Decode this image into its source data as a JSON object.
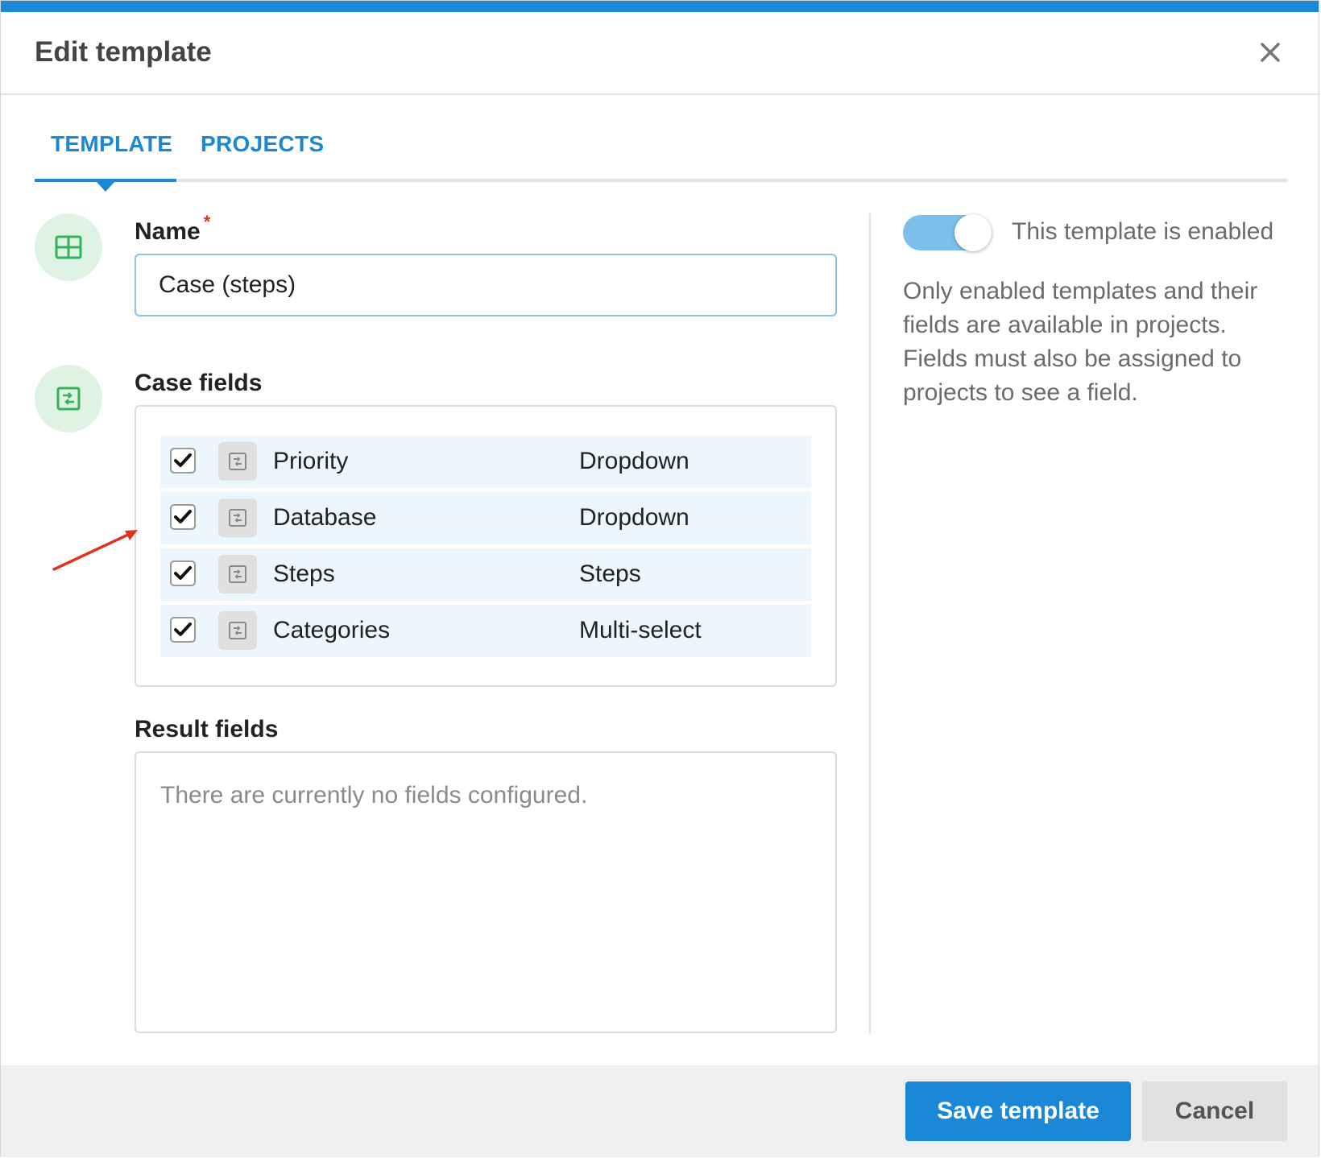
{
  "dialog": {
    "title": "Edit template",
    "accent_color": "#1a88d6"
  },
  "tabs": [
    {
      "label": "TEMPLATE",
      "active": true
    },
    {
      "label": "PROJECTS",
      "active": false
    }
  ],
  "name_field": {
    "label": "Name",
    "required_marker": "*",
    "value": "Case (steps)",
    "icon": "grid-icon"
  },
  "case_fields": {
    "label": "Case fields",
    "icon": "field-list-icon",
    "rows": [
      {
        "name": "Priority",
        "type": "Dropdown",
        "checked": true
      },
      {
        "name": "Database",
        "type": "Dropdown",
        "checked": true
      },
      {
        "name": "Steps",
        "type": "Steps",
        "checked": true
      },
      {
        "name": "Categories",
        "type": "Multi-select",
        "checked": true
      }
    ]
  },
  "result_fields": {
    "label": "Result fields",
    "empty_text": "There are currently no fields configured."
  },
  "status": {
    "toggle_label": "This template is enabled",
    "enabled": true,
    "help_text": "Only enabled templates and their fields are available in projects. Fields must also be assigned to projects to see a field."
  },
  "footer": {
    "save_label": "Save template",
    "cancel_label": "Cancel"
  },
  "annotation_color": "#e0331f"
}
